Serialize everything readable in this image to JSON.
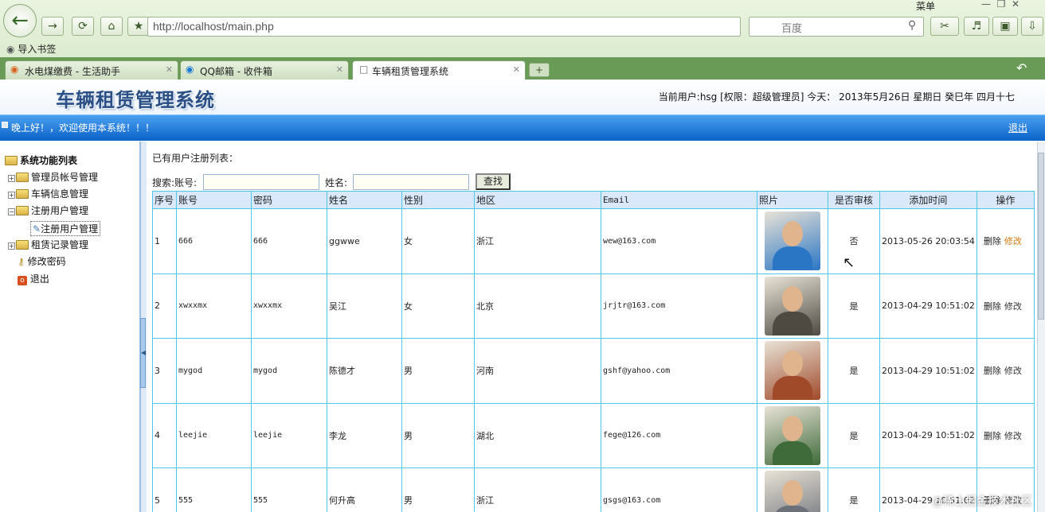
{
  "browser": {
    "url": "http://localhost/main.php",
    "search_placeholder": "百度",
    "bookmark": "导入书签",
    "menu": "菜单",
    "tabs": [
      {
        "label": "水电煤缴费 - 生活助手"
      },
      {
        "label": "QQ邮箱 - 收件箱"
      },
      {
        "label": "车辆租赁管理系统"
      }
    ]
  },
  "app": {
    "title": "车辆租赁管理系统",
    "user_info": "当前用户:hsg [权限：超级管理员] 今天： 2013年5月26日 星期日 癸巳年 四月十七",
    "greeting": "晚上好！，欢迎使用本系统！！！",
    "logout": "退出"
  },
  "sidebar": {
    "root": "系统功能列表",
    "items": [
      {
        "label": "管理员帐号管理"
      },
      {
        "label": "车辆信息管理"
      },
      {
        "label": "注册用户管理"
      },
      {
        "label": "注册用户管理"
      },
      {
        "label": "租赁记录管理"
      },
      {
        "label": "修改密码"
      },
      {
        "label": "退出"
      }
    ]
  },
  "main": {
    "title": "已有用户注册列表：",
    "search_label": "搜索:账号:",
    "name_label": "姓名:",
    "find_button": "查找",
    "columns": [
      "序号",
      "账号",
      "密码",
      "姓名",
      "性别",
      "地区",
      "Email",
      "照片",
      "是否审核",
      "添加时间",
      "操作"
    ],
    "delete_label": "删除",
    "edit_label": "修改",
    "rows": [
      {
        "no": "1",
        "account": "666",
        "password": "666",
        "name": "ggwwe",
        "gender": "女",
        "region": "浙江",
        "email": "wew@163.com",
        "reviewed": "否",
        "time": "2013-05-26 20:03:54",
        "photo_color": "#2a76c5"
      },
      {
        "no": "2",
        "account": "xwxxmx",
        "password": "xwxxmx",
        "name": "吴江",
        "gender": "女",
        "region": "北京",
        "email": "jrjtr@163.com",
        "reviewed": "是",
        "time": "2013-04-29 10:51:02",
        "photo_color": "#4e4a42"
      },
      {
        "no": "3",
        "account": "mygod",
        "password": "mygod",
        "name": "陈德才",
        "gender": "男",
        "region": "河南",
        "email": "gshf@yahoo.com",
        "reviewed": "是",
        "time": "2013-04-29 10:51:02",
        "photo_color": "#a04a2a"
      },
      {
        "no": "4",
        "account": "leejie",
        "password": "leejie",
        "name": "李龙",
        "gender": "男",
        "region": "湖北",
        "email": "fege@126.com",
        "reviewed": "是",
        "time": "2013-04-29 10:51:02",
        "photo_color": "#3f6a3a"
      },
      {
        "no": "5",
        "account": "555",
        "password": "555",
        "name": "何升高",
        "gender": "男",
        "region": "浙江",
        "email": "gsgs@163.com",
        "reviewed": "是",
        "time": "2013-04-29 10:51:02",
        "photo_color": "#6c7078"
      }
    ]
  },
  "watermark": "@稀土掘金技术社区"
}
